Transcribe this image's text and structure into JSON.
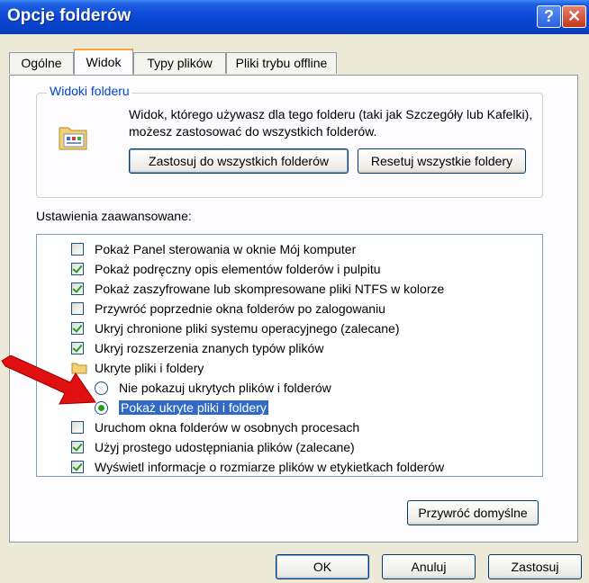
{
  "window": {
    "title": "Opcje folderów"
  },
  "titlebar_buttons": {
    "help_label": "?",
    "close_label": "✕"
  },
  "tabs": [
    {
      "label": "Ogólne"
    },
    {
      "label": "Widok"
    },
    {
      "label": "Typy plików"
    },
    {
      "label": "Pliki trybu offline"
    }
  ],
  "folder_views": {
    "legend": "Widoki folderu",
    "description": "Widok, którego używasz dla tego folderu (taki jak Szczegóły lub Kafelki), możesz zastosować do wszystkich folderów.",
    "apply_all_label": "Zastosuj do wszystkich folderów",
    "reset_all_label": "Resetuj wszystkie foldery"
  },
  "advanced": {
    "label": "Ustawienia zaawansowane:",
    "items": [
      {
        "type": "checkbox",
        "checked": false,
        "label": "Pokaż Panel sterowania w oknie Mój komputer"
      },
      {
        "type": "checkbox",
        "checked": true,
        "label": "Pokaż podręczny opis elementów folderów i pulpitu"
      },
      {
        "type": "checkbox",
        "checked": true,
        "label": "Pokaż zaszyfrowane lub skompresowane pliki NTFS w kolorze"
      },
      {
        "type": "checkbox",
        "checked": false,
        "label": "Przywróć poprzednie okna folderów po zalogowaniu"
      },
      {
        "type": "checkbox",
        "checked": true,
        "label": "Ukryj chronione pliki systemu operacyjnego (zalecane)"
      },
      {
        "type": "checkbox",
        "checked": true,
        "label": "Ukryj rozszerzenia znanych typów plików"
      },
      {
        "type": "folder",
        "label": "Ukryte pliki i foldery"
      },
      {
        "type": "radio",
        "selected": false,
        "label": "Nie pokazuj ukrytych plików i folderów"
      },
      {
        "type": "radio",
        "selected": true,
        "label": "Pokaż ukryte pliki i foldery"
      },
      {
        "type": "checkbox",
        "checked": false,
        "label": "Uruchom okna folderów w osobnych procesach"
      },
      {
        "type": "checkbox",
        "checked": true,
        "label": "Użyj prostego udostępniania plików (zalecane)"
      },
      {
        "type": "checkbox",
        "checked": true,
        "label": "Wyświetl informacje o rozmiarze plików w etykietkach folderów"
      }
    ],
    "restore_defaults_label": "Przywróć domyślne"
  },
  "footer": {
    "ok_label": "OK",
    "cancel_label": "Anuluj",
    "apply_label": "Zastosuj"
  },
  "colors": {
    "title_bar": "#0a47d6",
    "selection": "#316ac5",
    "check_mark": "#21a121",
    "annotation_arrow": "#e01010"
  },
  "icons": {
    "help": "help-icon",
    "close": "close-icon",
    "folder_views": "folder-views-icon",
    "folder": "folder-icon",
    "annotation": "red-arrow-icon"
  }
}
